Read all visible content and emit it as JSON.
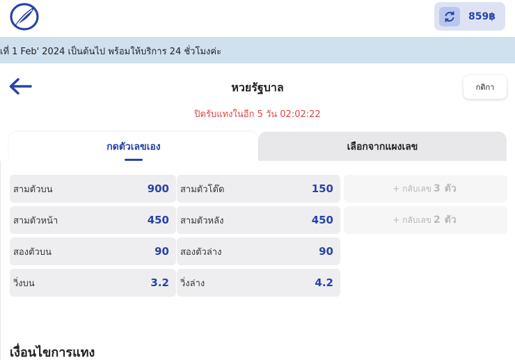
{
  "header": {
    "balance": "859฿",
    "refresh_icon": "refresh-icon",
    "logo_icon": "feather-logo-icon"
  },
  "announcement": {
    "text": "เที่ 1 Feb' 2024 เป็นต้นไป พร้อมให้บริการ 24 ชั่วโมงค่ะ"
  },
  "title_bar": {
    "title": "หวยรัฐบาล",
    "rules_label": "กติกา",
    "back_icon": "arrow-left-icon",
    "countdown": "ปิดรับแทงในอีก 5 วัน 02:02:22"
  },
  "tabs": [
    {
      "label": "กดตัวเลขเอง",
      "active": true
    },
    {
      "label": "เลือกจากแผงเลข",
      "active": false
    }
  ],
  "rates": [
    {
      "label": "สามตัวบน",
      "value": "900"
    },
    {
      "label": "สามตัวโต๊ด",
      "value": "150"
    },
    {
      "label": "สามตัวหน้า",
      "value": "450"
    },
    {
      "label": "สามตัวหลัง",
      "value": "450"
    },
    {
      "label": "สองตัวบน",
      "value": "90"
    },
    {
      "label": "สองตัวล่าง",
      "value": "90"
    },
    {
      "label": "วิ่งบน",
      "value": "3.2"
    },
    {
      "label": "วิ่งล่าง",
      "value": "4.2"
    }
  ],
  "reverse": [
    {
      "prefix": "+ กลับเลข",
      "count": "3",
      "suffix": "ตัว"
    },
    {
      "prefix": "+ กลับเลข",
      "count": "2",
      "suffix": "ตัว"
    }
  ],
  "conditions_title": "เงื่อนไขการแทง",
  "colors": {
    "accent": "#2843a8",
    "countdown": "#e04444",
    "announcement_bg": "#cfe0ef"
  }
}
